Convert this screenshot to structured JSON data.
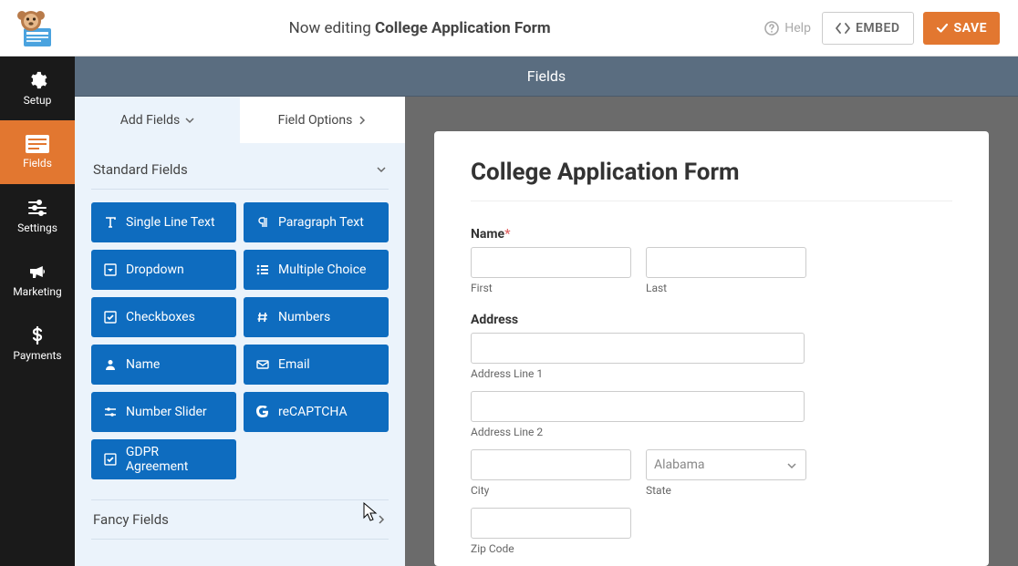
{
  "top": {
    "editing_prefix": "Now editing",
    "form_name": "College Application Form",
    "help": "Help",
    "embed": "EMBED",
    "save": "SAVE"
  },
  "nav": {
    "setup": "Setup",
    "fields": "Fields",
    "settings": "Settings",
    "marketing": "Marketing",
    "payments": "Payments"
  },
  "panel": {
    "header": "Fields",
    "tab_add": "Add Fields",
    "tab_options": "Field Options",
    "section_standard": "Standard Fields",
    "section_fancy": "Fancy Fields",
    "items": {
      "single_line_text": "Single Line Text",
      "paragraph_text": "Paragraph Text",
      "dropdown": "Dropdown",
      "multiple_choice": "Multiple Choice",
      "checkboxes": "Checkboxes",
      "numbers": "Numbers",
      "name": "Name",
      "email": "Email",
      "number_slider": "Number Slider",
      "recaptcha": "reCAPTCHA",
      "gdpr": "GDPR Agreement"
    }
  },
  "form": {
    "title": "College Application Form",
    "name_label": "Name",
    "name_required": "*",
    "first": "First",
    "last": "Last",
    "address_label": "Address",
    "addr1": "Address Line 1",
    "addr2": "Address Line 2",
    "city": "City",
    "state": "State",
    "state_value": "Alabama",
    "zip": "Zip Code"
  }
}
